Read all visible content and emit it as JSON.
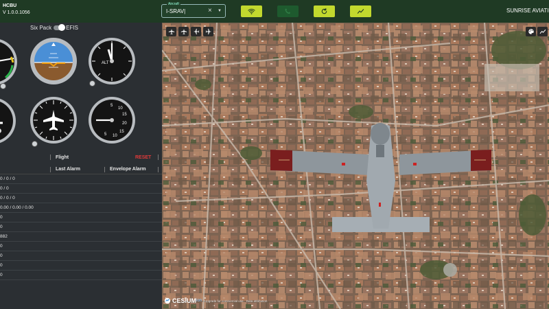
{
  "header": {
    "app_name": "HCBU",
    "version": "V 1.0.0.1056",
    "aircraft_label": "Aircraft",
    "aircraft_value": "I-SRAV|",
    "clear_symbol": "×",
    "caret_symbol": "▼",
    "company": "SUNRISE AVIATION",
    "buttons": [
      {
        "name": "wifi-button",
        "icon": "wifi-icon"
      },
      {
        "name": "phone-button",
        "icon": "phone-icon"
      },
      {
        "name": "refresh-button",
        "icon": "refresh-icon"
      },
      {
        "name": "trend-button",
        "icon": "trend-icon"
      }
    ]
  },
  "panel": {
    "toggle_left": "Six Pack",
    "toggle_right": "EFIS",
    "gauges": [
      "airspeed-indicator",
      "attitude-indicator",
      "altimeter",
      "turn-coordinator",
      "heading-indicator",
      "vertical-speed-indicator"
    ],
    "altimeter_label": "ALT",
    "vsi_ticks": [
      "5",
      "10",
      "15",
      "20",
      "15",
      "10",
      "5"
    ]
  },
  "table": {
    "flight_header": "Flight",
    "reset_label": "RESET",
    "last_alarm_header": "Last Alarm",
    "envelope_alarm_header": "Envelope Alarm",
    "rows": [
      "0 / 0 / 0",
      "0 / 0",
      "0 / 0 / 0",
      "0.00 / 0.00 / 0.00",
      "0",
      "0",
      "882",
      "0",
      "0",
      "0",
      "0"
    ]
  },
  "map": {
    "credit_logo": "CESIUM",
    "credit_ion": "ion",
    "credit_text": "Upgrade for commercial use.",
    "credit_link": "Data attribution"
  },
  "colors": {
    "topbar": "#1f3a24",
    "accent": "#c2d92e",
    "reset": "#e03a3a",
    "panel": "#2b2f33"
  }
}
